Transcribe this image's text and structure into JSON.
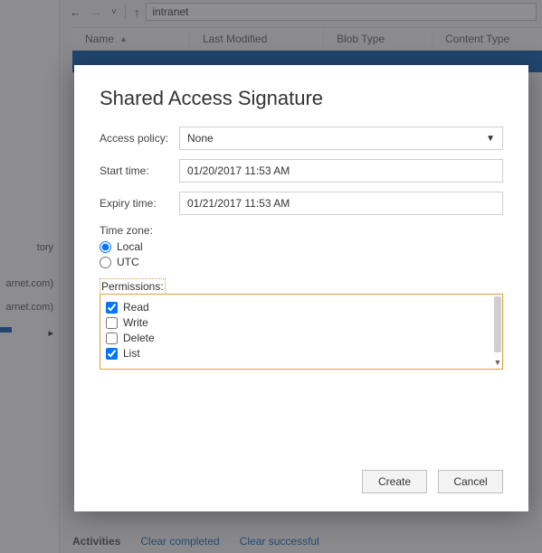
{
  "toolbar": {
    "path_value": "intranet"
  },
  "grid": {
    "columns": {
      "name": "Name",
      "last_modified": "Last Modified",
      "blob_type": "Blob Type",
      "content_type": "Content Type"
    }
  },
  "sidebar": {
    "item_tory": "tory",
    "item_arnet1": "arnet.com)",
    "item_arnet2": "arnet.com)",
    "expand_glyph": "▸"
  },
  "activities": {
    "title": "Activities",
    "clear_completed": "Clear completed",
    "clear_successful": "Clear successful"
  },
  "dialog": {
    "title": "Shared Access Signature",
    "access_policy_label": "Access policy:",
    "access_policy_value": "None",
    "start_time_label": "Start time:",
    "start_time_value": "01/20/2017 11:53 AM",
    "expiry_time_label": "Expiry time:",
    "expiry_time_value": "01/21/2017 11:53 AM",
    "time_zone_label": "Time zone:",
    "tz_local": "Local",
    "tz_utc": "UTC",
    "permissions_label": "Permissions:",
    "perm_read": "Read",
    "perm_write": "Write",
    "perm_delete": "Delete",
    "perm_list": "List",
    "create_btn": "Create",
    "cancel_btn": "Cancel"
  }
}
